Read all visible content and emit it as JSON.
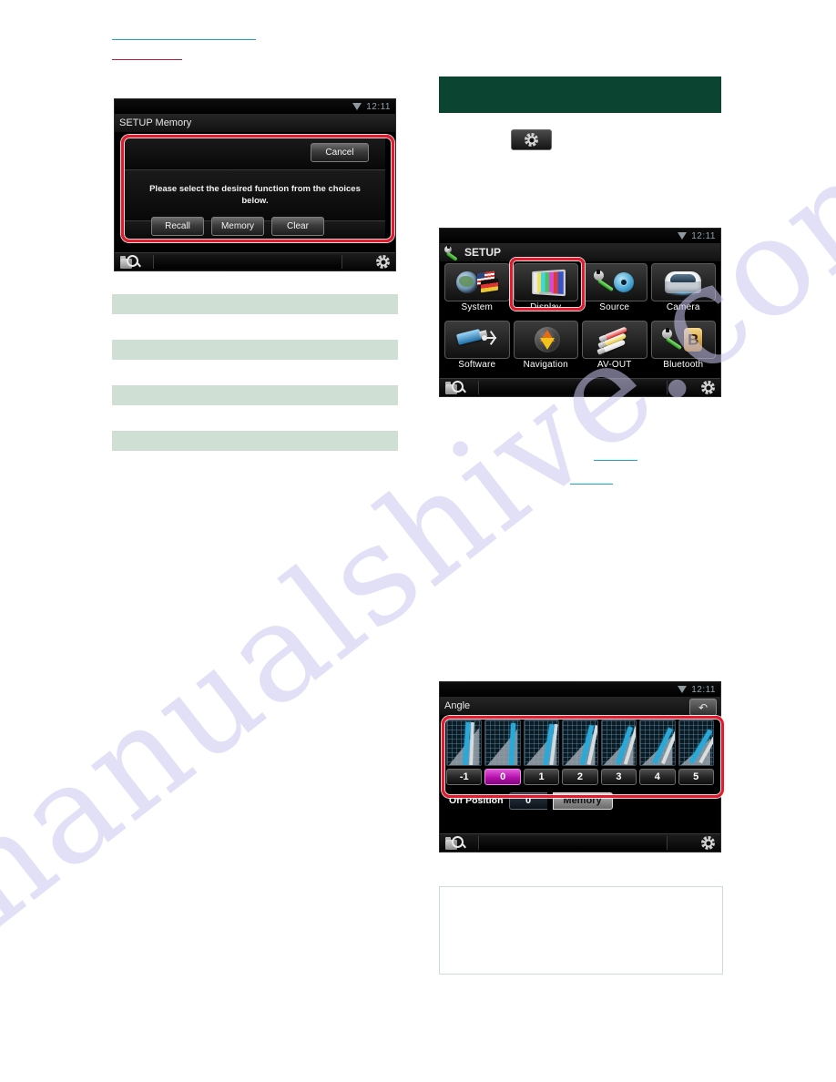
{
  "watermark": "manualshive.com",
  "left_column": {
    "top_rules": [
      {
        "kind": "blue-rule"
      },
      {
        "kind": "red-rule"
      }
    ],
    "redaction_bars": 4
  },
  "right_column": {
    "section_header": {
      "label": "",
      "color": "#0b4531"
    },
    "inline_gear_button": {
      "icon": "gear-icon"
    },
    "link_rules": 2,
    "note_box": {
      "text": ""
    }
  },
  "screenshots": {
    "setup_memory": {
      "status": {
        "wifi_icon": "wifi-icon",
        "clock": "12:11"
      },
      "title": "SETUP Memory",
      "cancel_label": "Cancel",
      "message": "Please select the desired function from the choices below.",
      "buttons": [
        {
          "label": "Recall"
        },
        {
          "label": "Memory"
        },
        {
          "label": "Clear"
        }
      ],
      "bottom_bar": {
        "left_icon": "file-search-icon",
        "right_icon": "gear-icon"
      },
      "highlight_color": "#e8192c"
    },
    "setup_menu": {
      "status": {
        "wifi_icon": "wifi-icon",
        "clock": "12:11"
      },
      "title": "SETUP",
      "title_icon": "wrench-icon",
      "tiles": [
        {
          "label": "System",
          "icon": "globe-flags-icon",
          "selected": false
        },
        {
          "label": "Display",
          "icon": "color-bars-tv-icon",
          "selected": true
        },
        {
          "label": "Source",
          "icon": "wrench-disc-icon",
          "selected": false
        },
        {
          "label": "Camera",
          "icon": "car-rear-icon",
          "selected": false
        },
        {
          "label": "Software",
          "icon": "usb-drive-icon",
          "selected": false
        },
        {
          "label": "Navigation",
          "icon": "compass-icon",
          "selected": false
        },
        {
          "label": "AV-OUT",
          "icon": "rca-cables-icon",
          "selected": false
        },
        {
          "label": "Bluetooth",
          "icon": "wrench-bluetooth-icon",
          "selected": false
        }
      ],
      "bottom_bar": {
        "left_icon": "file-search-icon",
        "right_icon": "gear-icon"
      },
      "highlight_color": "#e8192c"
    },
    "angle": {
      "status": {
        "wifi_icon": "wifi-icon",
        "clock": "12:11"
      },
      "title": "Angle",
      "back_icon": "back-arrow-icon",
      "presets": [
        {
          "label": "-1",
          "selected": false
        },
        {
          "label": "0",
          "selected": true
        },
        {
          "label": "1",
          "selected": false
        },
        {
          "label": "2",
          "selected": false
        },
        {
          "label": "3",
          "selected": false
        },
        {
          "label": "4",
          "selected": false
        },
        {
          "label": "5",
          "selected": false
        }
      ],
      "off_position": {
        "label": "Off Position",
        "value": "0",
        "memory_label": "Memory"
      },
      "bottom_bar": {
        "left_icon": "file-search-icon",
        "right_icon": "gear-icon"
      },
      "highlight_color": "#e8192c"
    }
  }
}
